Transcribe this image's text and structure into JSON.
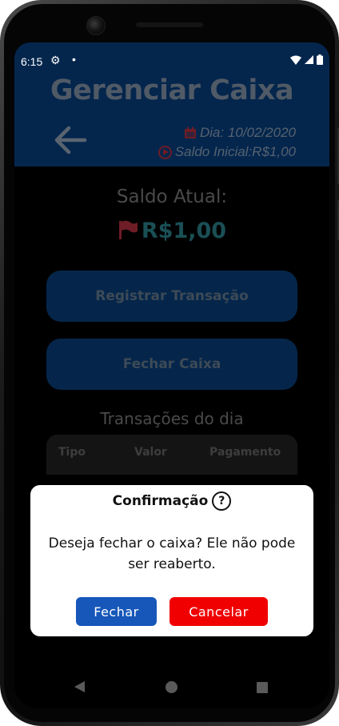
{
  "status_bar": {
    "time": "6:15",
    "icons": [
      "settings-icon",
      "dot-icon",
      "wifi-icon",
      "signal-icon",
      "battery-icon"
    ]
  },
  "header": {
    "title": "Gerenciar Caixa",
    "date_text": "Dia: 10/02/2020",
    "saldo_inicial_text": "Saldo Inicial:R$1,00"
  },
  "saldo": {
    "label": "Saldo Atual:",
    "value": "R$1,00"
  },
  "buttons": {
    "registrar": "Registrar Transação",
    "fechar_caixa": "Fechar Caixa"
  },
  "transacoes": {
    "title": "Transações do dia",
    "columns": [
      "Tipo",
      "Valor",
      "Pagamento"
    ]
  },
  "dialog": {
    "title": "Confirmação",
    "help_glyph": "?",
    "message": "Deseja fechar o caixa? Ele não pode ser reaberto.",
    "confirm_label": "Fechar",
    "cancel_label": "Cancelar"
  },
  "colors": {
    "header_bg": "#04264d",
    "button_bg": "#05264a",
    "confirm": "#1657b9",
    "cancel": "#f00000",
    "accent_red": "#6e1d26",
    "saldo_value": "#1a4f55"
  }
}
